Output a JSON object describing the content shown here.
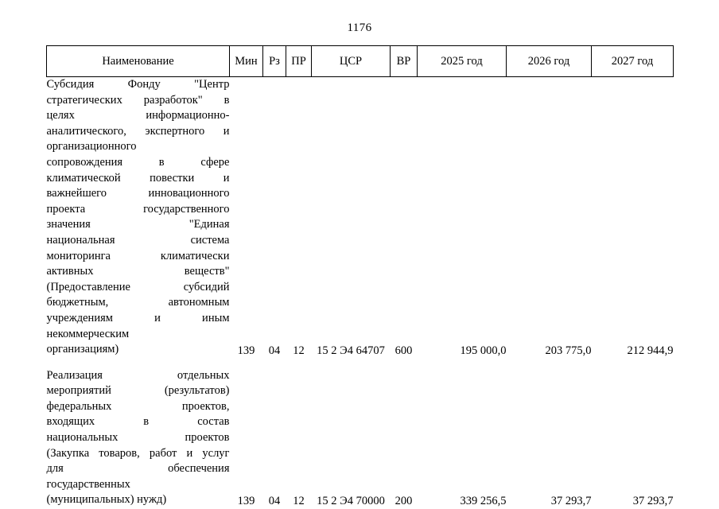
{
  "page": {
    "number": "1176"
  },
  "table": {
    "headers": {
      "name": "Наименование",
      "min": "Мин",
      "rz": "Рз",
      "pr": "ПР",
      "csr": "ЦСР",
      "vr": "ВР",
      "year2025": "2025 год",
      "year2026": "2026 год",
      "year2027": "2027 год"
    },
    "rows": [
      {
        "name_lines": [
          "Субсидия Фонду \"Центр",
          "стратегических разработок\" в",
          "целях информационно-",
          "аналитического, экспертного и",
          "организационного",
          "сопровождения в сфере",
          "климатической повестки и",
          "важнейшего инновационного",
          "проекта государственного",
          "значения \"Единая",
          "национальная система",
          "мониторинга климатически",
          "активных веществ\"",
          "(Предоставление субсидий",
          "бюджетным, автономным",
          "учреждениям и иным",
          "некоммерческим",
          "организациям)"
        ],
        "name_justified_count": 16,
        "min": "139",
        "rz": "04",
        "pr": "12",
        "csr": "15 2 Э4 64707",
        "vr": "600",
        "year2025": "195 000,0",
        "year2026": "203 775,0",
        "year2027": "212 944,9"
      },
      {
        "name_lines": [
          "Реализация отдельных",
          "мероприятий (результатов)",
          "федеральных проектов,",
          "входящих в состав",
          "национальных проектов",
          "(Закупка товаров, работ и услуг",
          "для обеспечения",
          "государственных",
          "(муниципальных) нужд)"
        ],
        "name_justified_count": 7,
        "min": "139",
        "rz": "04",
        "pr": "12",
        "csr": "15 2 Э4 70000",
        "vr": "200",
        "year2025": "339 256,5",
        "year2026": "37 293,7",
        "year2027": "37 293,7"
      }
    ]
  }
}
